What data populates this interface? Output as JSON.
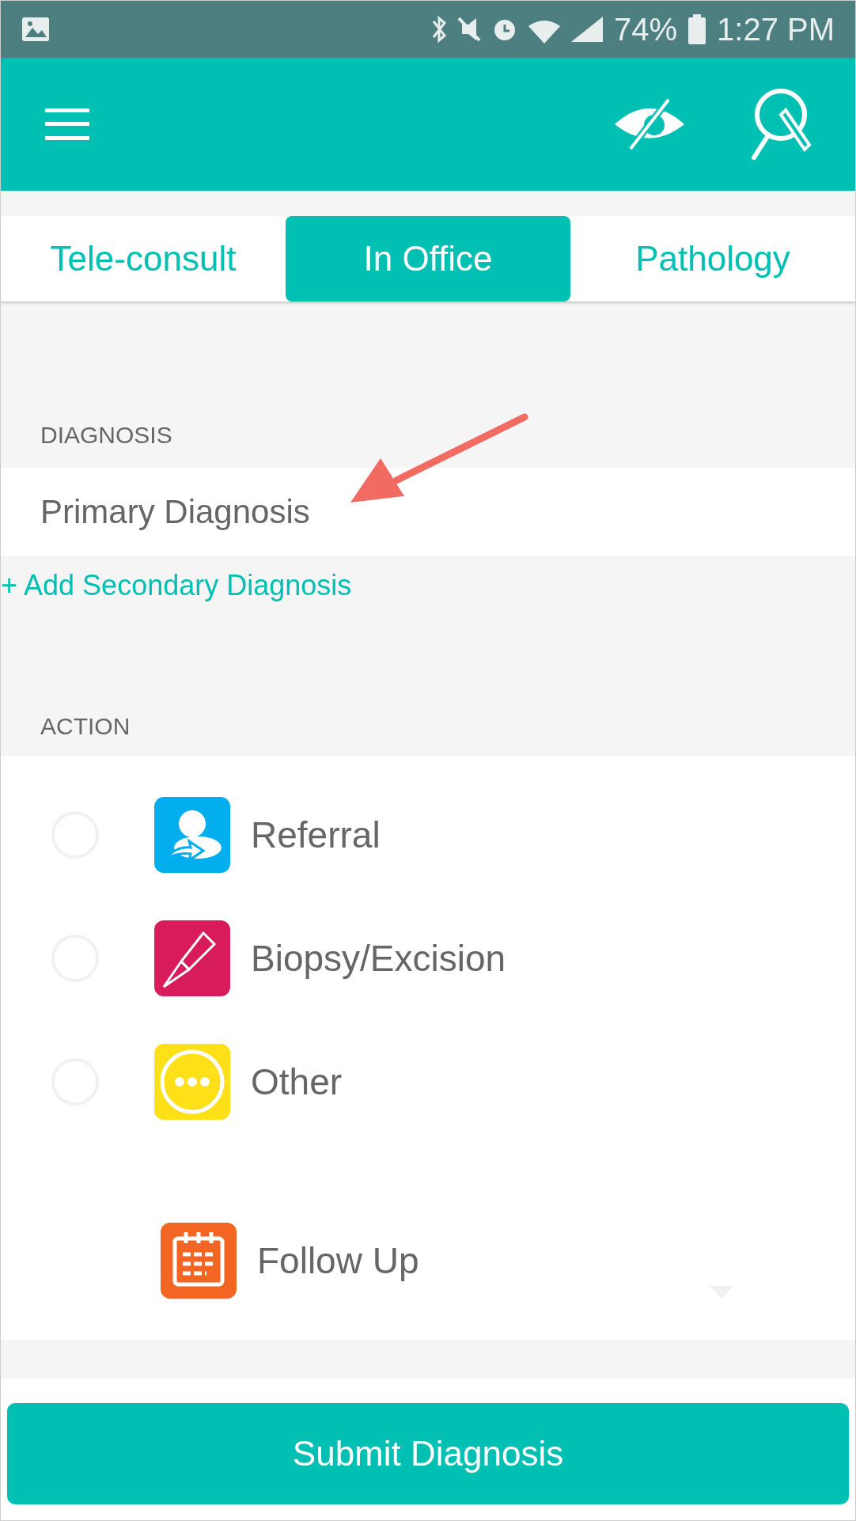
{
  "status_bar": {
    "battery": "74%",
    "time": "1:27 PM"
  },
  "visit_type": {
    "tabs": [
      {
        "label": "Tele-consult",
        "selected": false
      },
      {
        "label": "In Office",
        "selected": true
      },
      {
        "label": "Pathology",
        "selected": false
      }
    ]
  },
  "diagnosis": {
    "label": "DIAGNOSIS",
    "placeholder": "Primary Diagnosis",
    "add_link": "+ Add Secondary Diagnosis"
  },
  "action": {
    "label": "ACTION",
    "options": [
      {
        "kind": "radio",
        "label": "Referral",
        "selected": false,
        "color": "#03aeef"
      },
      {
        "kind": "radio",
        "label": "Biopsy/Excision",
        "selected": false,
        "color": "#d81b5a"
      },
      {
        "kind": "radio",
        "label": "Other",
        "selected": false,
        "color": "#fde018"
      },
      {
        "kind": "plain",
        "label": "Follow Up",
        "color": "#f26522"
      }
    ]
  },
  "submit_button": "Submit Diagnosis"
}
